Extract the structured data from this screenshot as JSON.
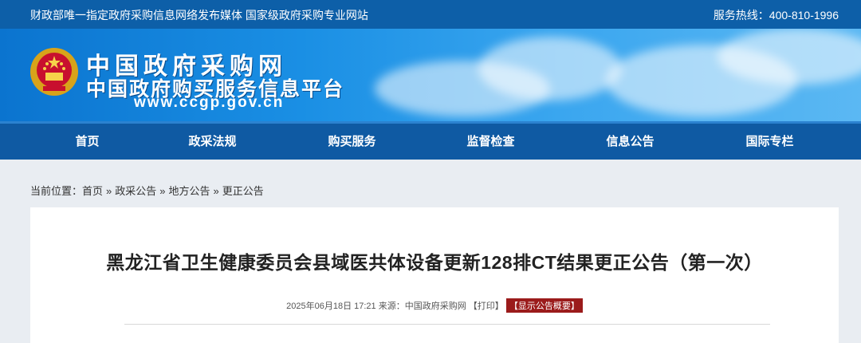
{
  "topbar": {
    "left": "财政部唯一指定政府采购信息网络发布媒体 国家级政府采购专业网站",
    "right": "服务热线：400-810-1996"
  },
  "header": {
    "site_name": "中国政府采购网",
    "site_subtitle": "中国政府购买服务信息平台",
    "site_url": "www.ccgp.gov.cn",
    "emblem_icon": "national-emblem-icon"
  },
  "nav": {
    "items": [
      {
        "label": "首页"
      },
      {
        "label": "政采法规"
      },
      {
        "label": "购买服务"
      },
      {
        "label": "监督检查"
      },
      {
        "label": "信息公告"
      },
      {
        "label": "国际专栏"
      }
    ]
  },
  "breadcrumb": {
    "prefix": "当前位置：",
    "items": [
      "首页",
      "政采公告",
      "地方公告",
      "更正公告"
    ],
    "separator": "»"
  },
  "article": {
    "title": "黑龙江省卫生健康委员会县域医共体设备更新128排CT结果更正公告（第一次）",
    "date": "2025年06月18日 17:21",
    "source_label": "来源：",
    "source": "中国政府采购网",
    "print_label": "【打印】",
    "summary_label": "【显示公告概要】"
  },
  "colors": {
    "topbar": "#0d5fa8",
    "nav": "#0f5aa3",
    "summary_button": "#9b1b1b",
    "background": "#e9edf2"
  }
}
